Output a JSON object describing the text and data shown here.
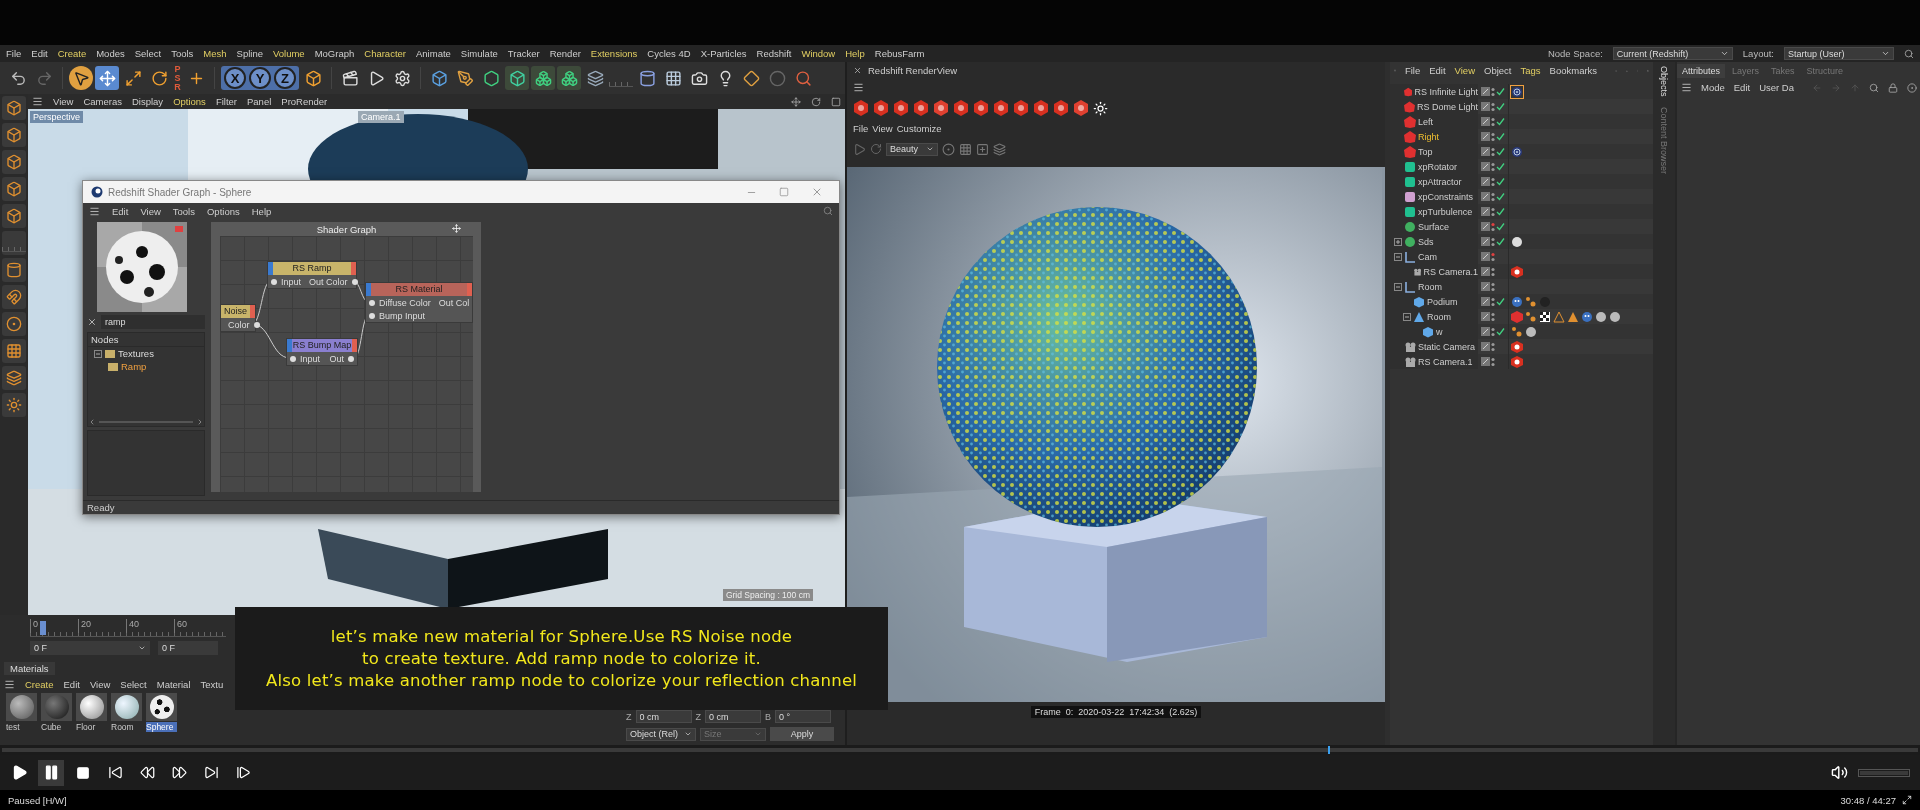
{
  "top_bar": {
    "node_space_label": "Node Space:",
    "node_space": "Current (Redshift)",
    "layout_label": "Layout:",
    "layout": "Startup (User)"
  },
  "menu": [
    {
      "label": "File",
      "accent": false
    },
    {
      "label": "Edit",
      "accent": false
    },
    {
      "label": "Create",
      "accent": true
    },
    {
      "label": "Modes",
      "accent": false
    },
    {
      "label": "Select",
      "accent": false
    },
    {
      "label": "Tools",
      "accent": false
    },
    {
      "label": "Mesh",
      "accent": true
    },
    {
      "label": "Spline",
      "accent": false
    },
    {
      "label": "Volume",
      "accent": true
    },
    {
      "label": "MoGraph",
      "accent": false
    },
    {
      "label": "Character",
      "accent": true
    },
    {
      "label": "Animate",
      "accent": false
    },
    {
      "label": "Simulate",
      "accent": false
    },
    {
      "label": "Tracker",
      "accent": false
    },
    {
      "label": "Render",
      "accent": false
    },
    {
      "label": "Extensions",
      "accent": true
    },
    {
      "label": "Cycles 4D",
      "accent": false
    },
    {
      "label": "X-Particles",
      "accent": false
    },
    {
      "label": "Redshift",
      "accent": false
    },
    {
      "label": "Window",
      "accent": true
    },
    {
      "label": "Help",
      "accent": true
    },
    {
      "label": "RebusFarm",
      "accent": false
    }
  ],
  "toolbar": {
    "psr": "PSR",
    "axes": [
      "X",
      "Y",
      "Z"
    ]
  },
  "viewport": {
    "menu": [
      {
        "label": "View",
        "accent": false
      },
      {
        "label": "Cameras",
        "accent": false
      },
      {
        "label": "Display",
        "accent": false
      },
      {
        "label": "Options",
        "accent": true
      },
      {
        "label": "Filter",
        "accent": false
      },
      {
        "label": "Panel",
        "accent": false
      },
      {
        "label": "ProRender",
        "accent": false
      }
    ],
    "camera_label": "Perspective",
    "camera_name": "Camera.1",
    "grid_spacing": "Grid Spacing : 100 cm"
  },
  "shader_graph": {
    "title": "Redshift Shader Graph - Sphere",
    "menu": [
      "Edit",
      "View",
      "Tools",
      "Options",
      "Help"
    ],
    "search": "ramp",
    "nodes_header": "Nodes",
    "tree": [
      {
        "label": "Textures",
        "selected": false,
        "expanded": true,
        "children": [
          {
            "label": "Ramp",
            "selected": true
          }
        ]
      }
    ],
    "canvas_title": "Shader Graph",
    "nodes": [
      {
        "title": "RS Ramp",
        "kind": "texture",
        "rows": [
          {
            "in": "Input",
            "out": "Out Color"
          }
        ]
      },
      {
        "title": "RS Material",
        "kind": "material",
        "rows": [
          {
            "in": "Diffuse Color",
            "out": "Out Col"
          },
          {
            "in": "Bump Input"
          }
        ]
      },
      {
        "title": "Noise",
        "kind": "texture",
        "rows": [
          {
            "out": "Color"
          }
        ]
      },
      {
        "title": "RS Bump Map",
        "kind": "bump",
        "rows": [
          {
            "in": "Input",
            "out": "Out"
          }
        ]
      }
    ],
    "status": "Ready"
  },
  "render_view": {
    "title": "Redshift RenderView",
    "menu": [
      "File",
      "View",
      "Customize"
    ],
    "aov": "Beauty",
    "frame_info": "Frame  0:  2020-03-22  17:42:34  (2.62s)"
  },
  "object_manager": {
    "menu": [
      {
        "label": "File",
        "accent": false
      },
      {
        "label": "Edit",
        "accent": false
      },
      {
        "label": "View",
        "accent": true
      },
      {
        "label": "Object",
        "accent": false
      },
      {
        "label": "Tags",
        "accent": true
      },
      {
        "label": "Bookmarks",
        "accent": false
      }
    ],
    "side_tabs": [
      "Objects",
      "Content Browser"
    ],
    "objects": [
      {
        "name": "RS Infinite Light",
        "kind": "light",
        "selected": false,
        "editor_hidden": false,
        "enabled": true,
        "tags": [
          {
            "kind": "target",
            "selected": true
          }
        ]
      },
      {
        "name": "RS Dome Light",
        "kind": "light",
        "selected": false,
        "editor_hidden": false,
        "enabled": true
      },
      {
        "name": "Left",
        "kind": "light",
        "selected": false,
        "editor_hidden": false,
        "enabled": true
      },
      {
        "name": "Right",
        "kind": "light",
        "selected": true,
        "editor_hidden": false,
        "enabled": true
      },
      {
        "name": "Top",
        "kind": "light",
        "selected": false,
        "editor_hidden": false,
        "enabled": true,
        "tags": [
          {
            "kind": "target",
            "selected": false
          }
        ]
      },
      {
        "name": "xpRotator",
        "kind": "rotator",
        "selected": false,
        "editor_hidden": false,
        "enabled": true
      },
      {
        "name": "xpAttractor",
        "kind": "attractor",
        "selected": false,
        "editor_hidden": false,
        "enabled": true
      },
      {
        "name": "xpConstraints",
        "kind": "constraints",
        "selected": false,
        "editor_hidden": false,
        "enabled": true
      },
      {
        "name": "xpTurbulence",
        "kind": "turbulence",
        "selected": false,
        "editor_hidden": false,
        "enabled": true
      },
      {
        "name": "Surface",
        "kind": "surface",
        "selected": false,
        "editor_hidden": true,
        "enabled": true
      },
      {
        "name": "Sds",
        "kind": "sds",
        "selected": false,
        "editor_hidden": false,
        "enabled": true,
        "expanded": false,
        "tags": [
          {
            "kind": "material-white",
            "selected": false
          }
        ]
      },
      {
        "name": "Cam",
        "kind": "null",
        "selected": false,
        "editor_hidden": true,
        "enabled": false,
        "expanded": true,
        "children": [
          {
            "name": "RS Camera.1",
            "kind": "camera",
            "selected": false,
            "editor_hidden": false,
            "enabled": false,
            "tags": [
              {
                "kind": "rs-camera",
                "selected": false
              }
            ]
          }
        ]
      },
      {
        "name": "Room",
        "kind": "null",
        "selected": false,
        "editor_hidden": false,
        "enabled": false,
        "expanded": true,
        "children": [
          {
            "name": "Podium",
            "kind": "cube",
            "selected": false,
            "editor_hidden": false,
            "enabled": true,
            "tags": [
              {
                "kind": "expresso",
                "selected": false
              },
              {
                "kind": "dots",
                "selected": false
              },
              {
                "kind": "material-dark",
                "selected": false
              }
            ]
          },
          {
            "name": "Room",
            "kind": "polygon",
            "selected": false,
            "editor_hidden": false,
            "enabled": false,
            "expanded": true,
            "tags": [
              {
                "kind": "rs-object",
                "selected": false
              },
              {
                "kind": "dots",
                "selected": false
              },
              {
                "kind": "checker",
                "selected": false
              },
              {
                "kind": "triangle-outline",
                "selected": false
              },
              {
                "kind": "triangle",
                "selected": false
              },
              {
                "kind": "expresso",
                "selected": false
              },
              {
                "kind": "material-light",
                "selected": false
              },
              {
                "kind": "material-light",
                "selected": false
              }
            ],
            "children": [
              {
                "name": "w",
                "kind": "cube",
                "selected": false,
                "editor_hidden": false,
                "enabled": true,
                "tags": [
                  {
                    "kind": "dots",
                    "selected": false
                  },
                  {
                    "kind": "material-light",
                    "selected": false
                  }
                ]
              }
            ]
          }
        ]
      },
      {
        "name": "Static Camera",
        "kind": "camera",
        "selected": false,
        "editor_hidden": false,
        "enabled": false,
        "tags": [
          {
            "kind": "rs-camera",
            "selected": false
          }
        ]
      },
      {
        "name": "RS Camera.1",
        "kind": "camera",
        "selected": false,
        "editor_hidden": false,
        "enabled": false,
        "tags": [
          {
            "kind": "rs-camera",
            "selected": false
          }
        ]
      }
    ]
  },
  "attributes": {
    "tabs": [
      {
        "label": "Attributes",
        "selected": true
      },
      {
        "label": "Layers",
        "selected": false
      },
      {
        "label": "Takes",
        "selected": false
      },
      {
        "label": "Structure",
        "selected": false
      }
    ],
    "menu": [
      "Mode",
      "Edit",
      "User Da"
    ]
  },
  "timeline": {
    "ticks": [
      "0",
      "20",
      "40",
      "60"
    ],
    "frame_fields": [
      "0 F",
      "0 F"
    ]
  },
  "materials": {
    "tab": "Materials",
    "menu": [
      {
        "label": "Create",
        "accent": true
      },
      {
        "label": "Edit",
        "accent": false
      },
      {
        "label": "View",
        "accent": false
      },
      {
        "label": "Select",
        "accent": false
      },
      {
        "label": "Material",
        "accent": false
      },
      {
        "label": "Textu",
        "accent": false
      }
    ],
    "items": [
      {
        "name": "test",
        "kind": "grey",
        "selected": false
      },
      {
        "name": "Cube",
        "kind": "dark",
        "selected": false
      },
      {
        "name": "Floor",
        "kind": "white",
        "selected": false
      },
      {
        "name": "Room",
        "kind": "light-blue",
        "selected": false
      },
      {
        "name": "Sphere",
        "kind": "spotted",
        "selected": true
      }
    ]
  },
  "coordinates": {
    "fields": [
      {
        "axis": "Z",
        "value": "0 cm"
      },
      {
        "axis": "Z",
        "value": "0 cm"
      },
      {
        "axis": "B",
        "value": "0 °"
      }
    ],
    "mode": "Object (Rel)",
    "size": {
      "label": "Size",
      "disabled": true
    },
    "apply": "Apply"
  },
  "subtitle": {
    "lines": [
      "let’s make new material for Sphere.Use RS Noise node",
      "to create texture. Add ramp node to colorize it.",
      "Also let’s make another ramp node to colorize your reflection channel"
    ]
  },
  "player": {
    "seek": {
      "level": 0.692
    },
    "volume": {
      "level": 1
    },
    "paused": true,
    "status": "Paused [H/W]",
    "time": "30:48 / 44:27"
  }
}
